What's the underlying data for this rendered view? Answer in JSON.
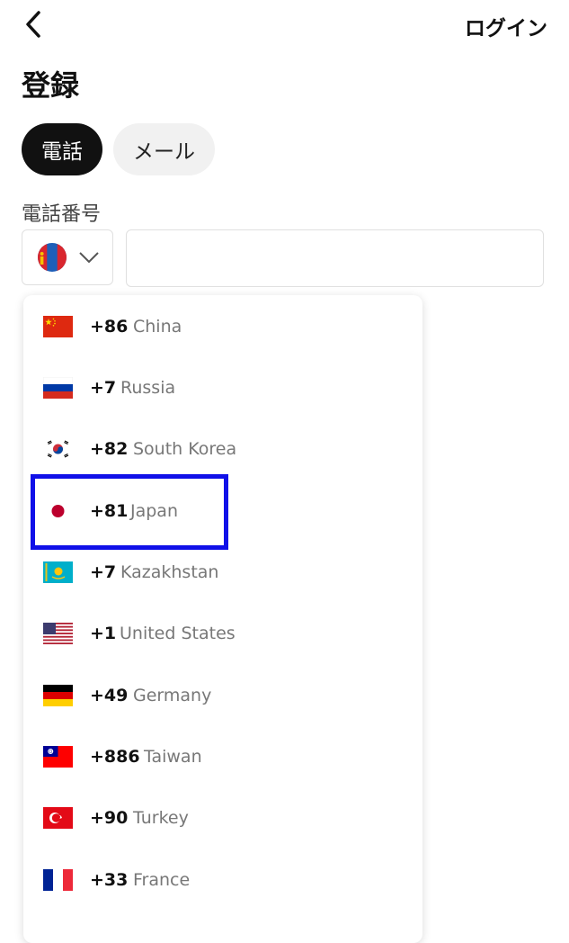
{
  "header": {
    "login_label": "ログイン"
  },
  "page": {
    "title": "登録"
  },
  "tabs": [
    {
      "label": "電話",
      "active": true
    },
    {
      "label": "メール",
      "active": false
    }
  ],
  "phone": {
    "field_label": "電話番号",
    "selected_flag": "mongolia-flag",
    "value": ""
  },
  "countries": [
    {
      "code": "+86",
      "name": "China",
      "flag": "china-flag"
    },
    {
      "code": "+7",
      "name": "Russia",
      "flag": "russia-flag"
    },
    {
      "code": "+82",
      "name": "South Korea",
      "flag": "south-korea-flag"
    },
    {
      "code": "+81",
      "name": "Japan",
      "flag": "japan-flag",
      "highlighted": true
    },
    {
      "code": "+7",
      "name": "Kazakhstan",
      "flag": "kazakhstan-flag"
    },
    {
      "code": "+1",
      "name": "United States",
      "flag": "united-states-flag"
    },
    {
      "code": "+49",
      "name": "Germany",
      "flag": "germany-flag"
    },
    {
      "code": "+886",
      "name": "Taiwan",
      "flag": "taiwan-flag"
    },
    {
      "code": "+90",
      "name": "Turkey",
      "flag": "turkey-flag"
    },
    {
      "code": "+33",
      "name": "France",
      "flag": "france-flag"
    }
  ],
  "colors": {
    "highlight_border": "#1010e8",
    "active_tab": "#111111"
  }
}
